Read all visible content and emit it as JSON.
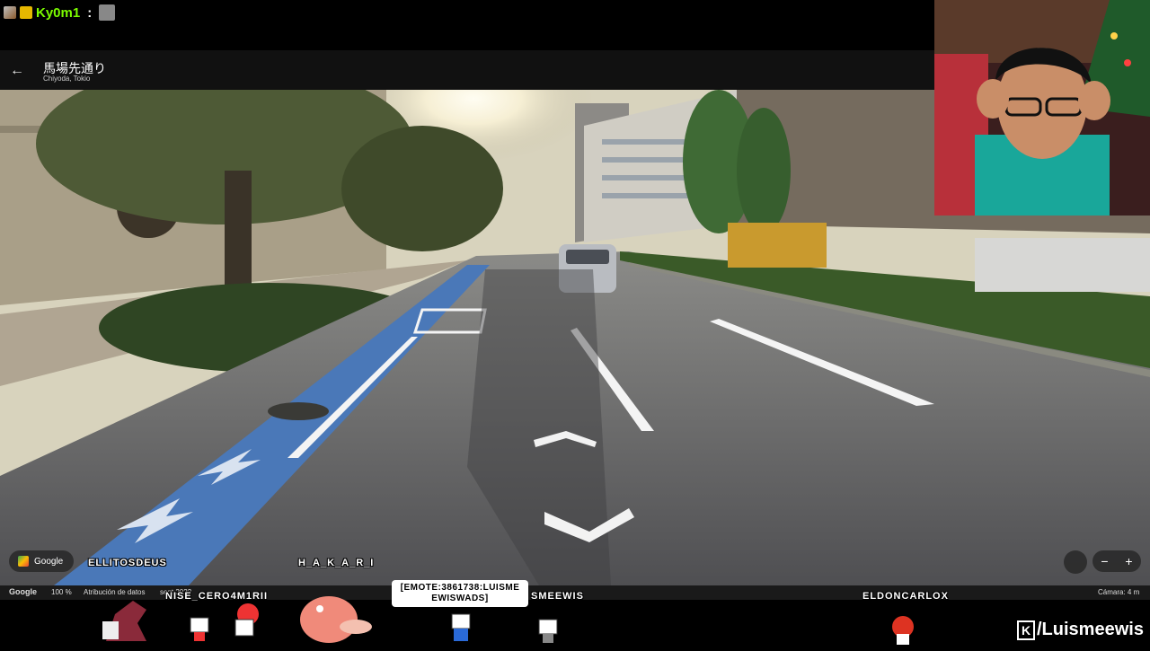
{
  "chat": {
    "username": "Ky0m1",
    "colon": ":",
    "badges": [
      "sword-badge-icon",
      "crown-badge-icon"
    ],
    "emote": "cat-emote-icon"
  },
  "streetview": {
    "back_icon": "arrow-back-icon",
    "street_name": "馬場先通り",
    "location": "Chiyoda, Tokio"
  },
  "map_footer": {
    "google_logo": "Google",
    "zoom": "100 %",
    "attribution": "Atribución de datos",
    "date": "sept 2022",
    "camera": "Cámara: 4 m",
    "google_badge": "Google",
    "zoom_out": "−",
    "zoom_in": "+"
  },
  "overlay": {
    "chatters": [
      "ELLITOSDEUS",
      "H_A_K_A_R_I",
      "NISE_CERO4M1RII",
      "SMEEWIS",
      "ELDONCARLOX"
    ],
    "tooltip": "[EMOTE:3861738:LUISME EWISWADS]",
    "brand": "/Luismeewis",
    "brand_mark": "K"
  },
  "colors": {
    "username": "#7CFC00",
    "bike_lane": "#4a78b8",
    "road": "#5a5a5c"
  }
}
